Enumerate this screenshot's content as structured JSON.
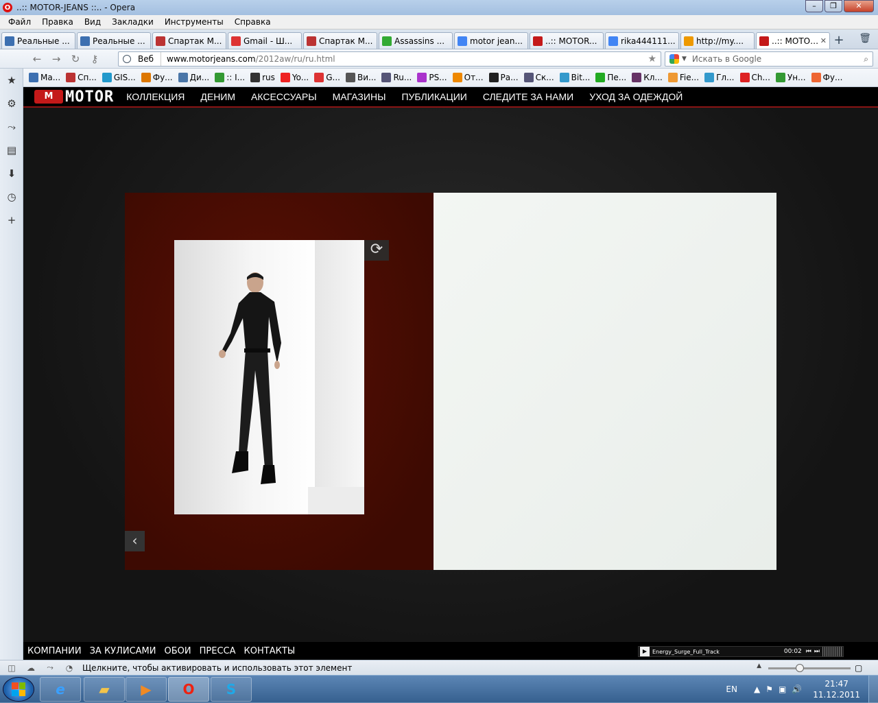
{
  "window": {
    "title": "..:: MOTOR-JEANS ::.. - Opera",
    "logo": "O"
  },
  "menu": [
    "Файл",
    "Правка",
    "Вид",
    "Закладки",
    "Инструменты",
    "Справка"
  ],
  "tabs": [
    {
      "label": "Реальные ...",
      "color": "#3c6fb0"
    },
    {
      "label": "Реальные ...",
      "color": "#3c6fb0"
    },
    {
      "label": "Спартак М...",
      "color": "#b33"
    },
    {
      "label": "Gmail - Ш...",
      "color": "#d33"
    },
    {
      "label": "Спартак М...",
      "color": "#b33"
    },
    {
      "label": "Assassins ...",
      "color": "#3a3"
    },
    {
      "label": "motor jean...",
      "color": "#4285f4"
    },
    {
      "label": "..:: MOTOR...",
      "color": "#c41919"
    },
    {
      "label": "rika444111...",
      "color": "#4285f4"
    },
    {
      "label": "http://my....",
      "color": "#e90"
    },
    {
      "label": "..:: MOTOR...",
      "color": "#c41919",
      "active": true
    }
  ],
  "address": {
    "mode": "Веб",
    "url_host": "www.motorjeans.com",
    "url_path": "/2012aw/ru/ru.html"
  },
  "search": {
    "placeholder": "Искать в Google"
  },
  "bookmarks": [
    {
      "label": "Ма...",
      "color": "#3c6fb0"
    },
    {
      "label": "Сп...",
      "color": "#b33"
    },
    {
      "label": "GIS...",
      "color": "#29c"
    },
    {
      "label": "Фу...",
      "color": "#d70"
    },
    {
      "label": "Ди...",
      "color": "#4a76a8"
    },
    {
      "label": ":: I...",
      "color": "#393"
    },
    {
      "label": "rus",
      "color": "#333"
    },
    {
      "label": "Yo...",
      "color": "#e22"
    },
    {
      "label": "G...",
      "color": "#d33"
    },
    {
      "label": "Ви...",
      "color": "#555"
    },
    {
      "label": "Ru...",
      "color": "#557"
    },
    {
      "label": "PS...",
      "color": "#a3c"
    },
    {
      "label": "От...",
      "color": "#e80"
    },
    {
      "label": "Ра...",
      "color": "#222"
    },
    {
      "label": "Ск...",
      "color": "#557"
    },
    {
      "label": "Bit...",
      "color": "#39c"
    },
    {
      "label": "Пе...",
      "color": "#2a2"
    },
    {
      "label": "Кл...",
      "color": "#636"
    },
    {
      "label": "Fie...",
      "color": "#e93"
    },
    {
      "label": "Гл...",
      "color": "#39c"
    },
    {
      "label": "Ch...",
      "color": "#d22"
    },
    {
      "label": "Ун...",
      "color": "#393"
    },
    {
      "label": "Фу...",
      "color": "#e63"
    }
  ],
  "site": {
    "brand_mark": "M",
    "brand_word": "MOTOR",
    "nav": [
      "КОЛЛЕКЦИЯ",
      "ДЕНИМ",
      "АКСЕССУАРЫ",
      "МАГАЗИНЫ",
      "ПУБЛИКАЦИИ",
      "СЛЕДИТЕ ЗА НАМИ",
      "УХОД ЗА ОДЕЖДОЙ"
    ],
    "footer": [
      "КОМПАНИИ",
      "ЗА КУЛИСАМИ",
      "ОБОИ",
      "ПРЕССА",
      "КОНТАКТЫ"
    ],
    "player": {
      "track": "Energy_Surge_Full_Track",
      "time": "00:02"
    },
    "colors": {
      "accent": "#c41919",
      "left_page": "#4a0c03",
      "right_page": "#eef2ee"
    }
  },
  "status": {
    "text": "Щелкните, чтобы активировать и использовать этот элемент"
  },
  "taskbar": {
    "lang": "EN",
    "time": "21:47",
    "date": "11.12.2011"
  }
}
